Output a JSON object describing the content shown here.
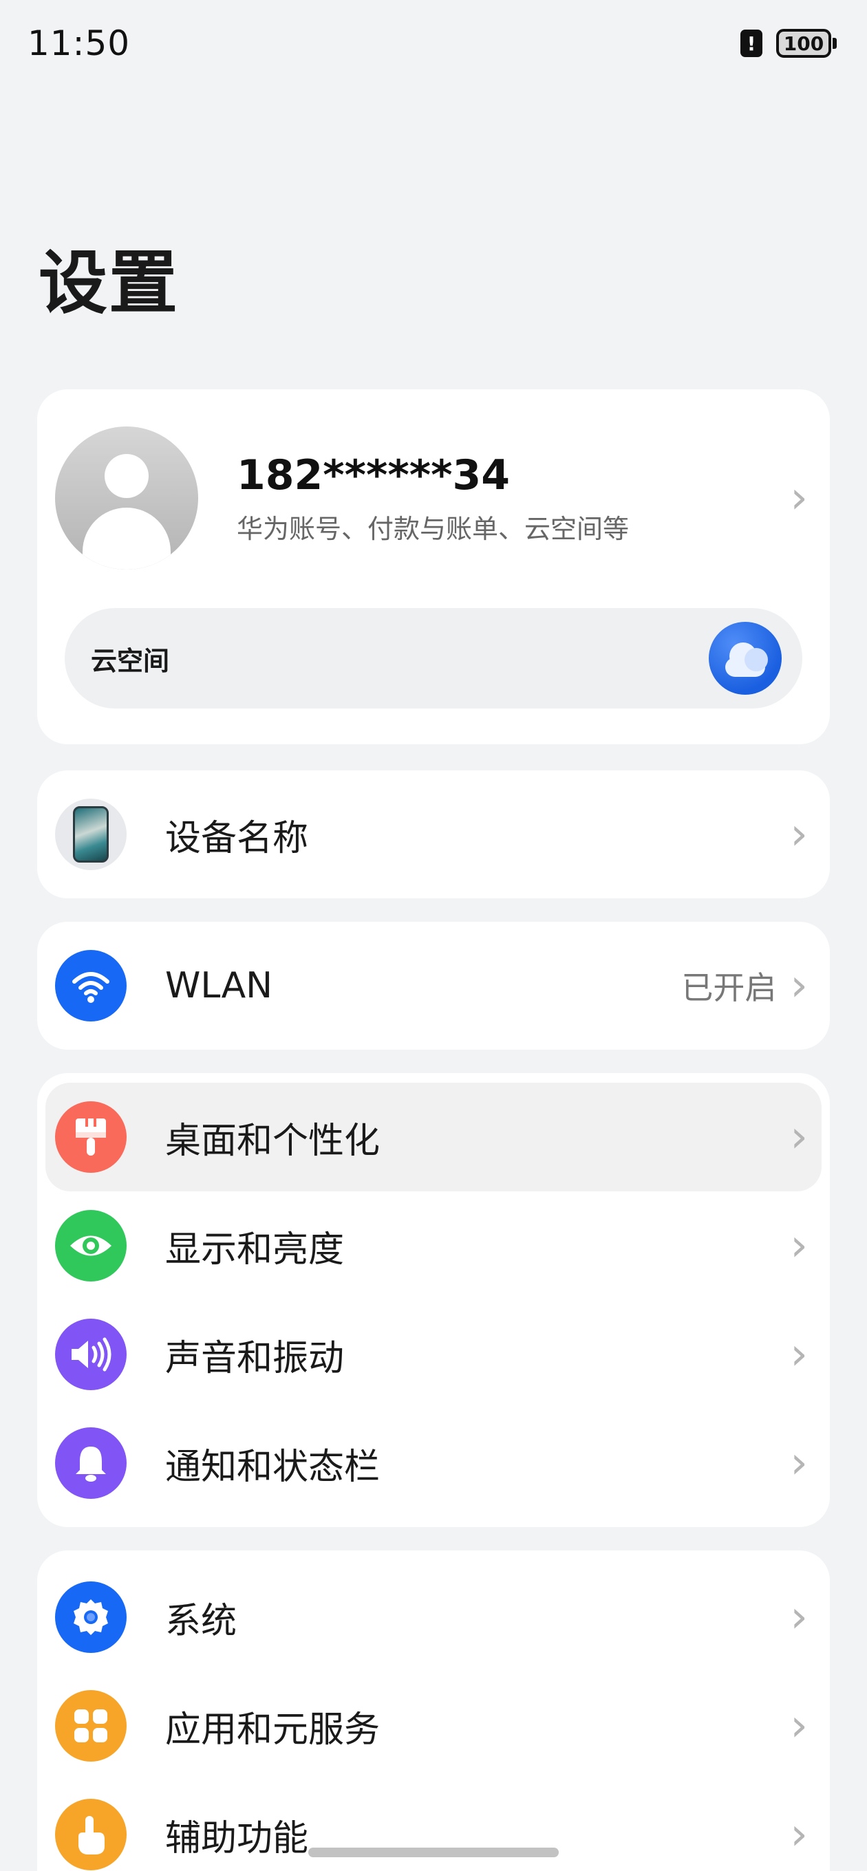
{
  "status_bar": {
    "time": "11:50",
    "alert_icon": "alert-icon",
    "battery": "100"
  },
  "page": {
    "title": "设置"
  },
  "account": {
    "name": "182******34",
    "subtitle": "华为账号、付款与账单、云空间等",
    "cloud_label": "云空间",
    "avatar_icon": "avatar-icon",
    "cloud_icon": "cloud-icon"
  },
  "rows": {
    "device": {
      "label": "设备名称",
      "icon": "device-icon"
    },
    "wlan": {
      "label": "WLAN",
      "value": "已开启",
      "icon": "wifi-icon",
      "color": "#1768f5"
    },
    "home": {
      "label": "桌面和个性化",
      "icon": "brush-icon",
      "color": "#fa6a5a"
    },
    "display": {
      "label": "显示和亮度",
      "icon": "eye-icon",
      "color": "#30c75b"
    },
    "sound": {
      "label": "声音和振动",
      "icon": "speaker-icon",
      "color": "#8155f5"
    },
    "notifications": {
      "label": "通知和状态栏",
      "icon": "bell-icon",
      "color": "#8155f5"
    },
    "system": {
      "label": "系统",
      "icon": "gear-icon",
      "color": "#1768f5"
    },
    "apps": {
      "label": "应用和元服务",
      "icon": "apps-icon",
      "color": "#f7a529"
    },
    "accessibility": {
      "label": "辅助功能",
      "icon": "hand-icon",
      "color": "#f7a529"
    }
  }
}
